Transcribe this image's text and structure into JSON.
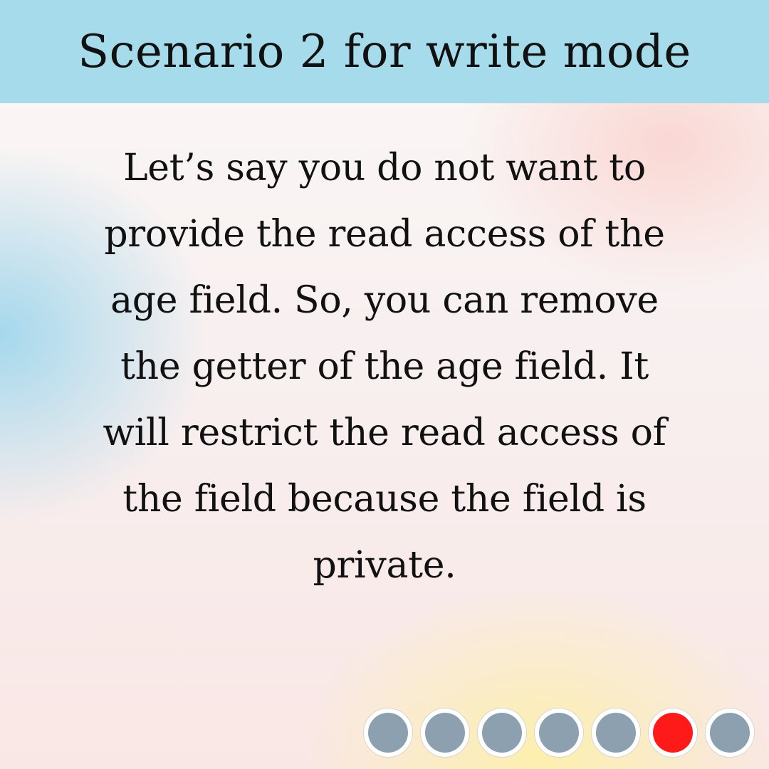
{
  "header": {
    "title": "Scenario 2 for write mode",
    "background_color": "#a5dbeb"
  },
  "body": {
    "lines": [
      "Let’s say you do not want to",
      "provide the read access of the",
      "age field. So, you can remove",
      "the getter of the age field. It",
      "will restrict the read access of",
      "the field because the field is",
      "private."
    ]
  },
  "pagination": {
    "total": 7,
    "active_index": 5,
    "active_color": "#ff1a1a",
    "inactive_color": "#8ca0b0"
  }
}
